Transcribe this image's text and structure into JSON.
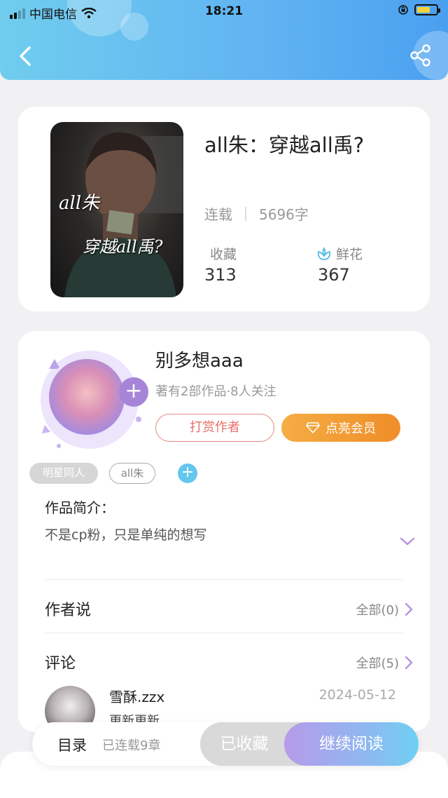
{
  "status_bar": {
    "carrier": "中国电信",
    "time": "18:21"
  },
  "book": {
    "title": "all朱：穿越all禹?",
    "cover_text_line1": "all朱",
    "cover_text_line2": "穿越all禹?",
    "status": "连载",
    "word_count": "5696字",
    "favorites_label": "收藏",
    "favorites_value": "313",
    "flowers_label": "鲜花",
    "flowers_value": "367"
  },
  "author": {
    "name": "别多想aaa",
    "stats": "著有2部作品·8人关注",
    "tip_label": "打赏作者",
    "vip_label": "点亮会员"
  },
  "tags": [
    "明星同人",
    "all朱"
  ],
  "intro": {
    "title": "作品简介：",
    "text": "不是cp粉，只是单纯的想写"
  },
  "author_says": {
    "title": "作者说",
    "all_label": "全部(0)"
  },
  "comments": {
    "title": "评论",
    "all_label": "全部(5)",
    "items": [
      {
        "user": "雪酥.zzx",
        "date": "2024-05-12",
        "text": "更新更新"
      }
    ]
  },
  "bottom_bar": {
    "toc_label": "目录",
    "toc_count": "已连载9章",
    "favorited_label": "已收藏",
    "continue_label": "继续阅读"
  },
  "colors": {
    "header_start": "#70cdee",
    "header_end": "#4aa0f0",
    "accent_purple": "#a685d9",
    "vip_orange": "#ef8d2a",
    "tip_red": "#e8706a"
  }
}
